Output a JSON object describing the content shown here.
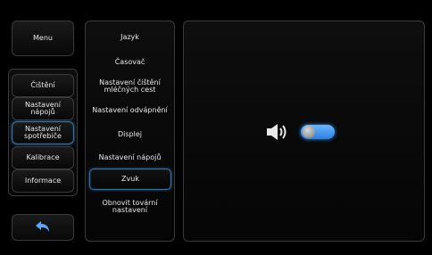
{
  "left_nav": {
    "menu_label": "Menu",
    "items": [
      {
        "label": "Čištění"
      },
      {
        "label": "Nastavení\nnápojů"
      },
      {
        "label": "Nastavení\nspotřebiče"
      },
      {
        "label": "Kalibrace"
      },
      {
        "label": "Informace"
      }
    ],
    "selected_index": 2,
    "back_icon": "back-arrow-icon"
  },
  "settings_list": {
    "items": [
      {
        "label": "Jazyk"
      },
      {
        "label": "Časovač"
      },
      {
        "label": "Nastavení čištění\nmléčných cest"
      },
      {
        "label": "Nastavení odvápnění"
      },
      {
        "label": "Displej"
      },
      {
        "label": "Nastavení nápojů"
      },
      {
        "label": "Zvuk"
      },
      {
        "label": "Obnovit tovární\nnastavení"
      }
    ],
    "selected_index": 6
  },
  "detail": {
    "speaker_icon": "speaker-icon",
    "sound_toggle_on": true
  },
  "colors": {
    "accent": "#3c6e9e",
    "toggle_on": "#4a9af0",
    "back_arrow": "#5aa7ff"
  }
}
